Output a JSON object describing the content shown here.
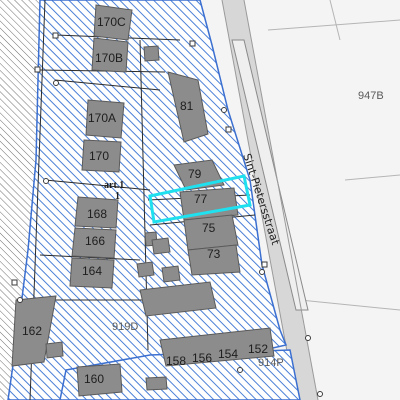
{
  "map": {
    "street_name": "Sint-Pietersstraat",
    "parcel_labels": {
      "p170c": "170C",
      "p170b": "170B",
      "p170a": "170A",
      "p170": "170",
      "p168": "168",
      "p166": "166",
      "p164": "164",
      "p162": "162",
      "p81": "81",
      "p79": "79",
      "p77": "77",
      "p75": "75",
      "p73": "73",
      "p158": "158",
      "p156": "156",
      "p154": "154",
      "p152": "152",
      "p160": "160",
      "p919d": "919D",
      "p914p": "914P",
      "p947b": "947B"
    },
    "annotation": {
      "line1": "art.1",
      "line2": "1"
    },
    "colors": {
      "hatch": "#4a7fd6",
      "highlight": "#1fe0ee",
      "building": "#8c8c8c",
      "road": "#d7d7d7",
      "outline": "#3b6fd0",
      "outer_lines": "#b5b5b5"
    }
  }
}
